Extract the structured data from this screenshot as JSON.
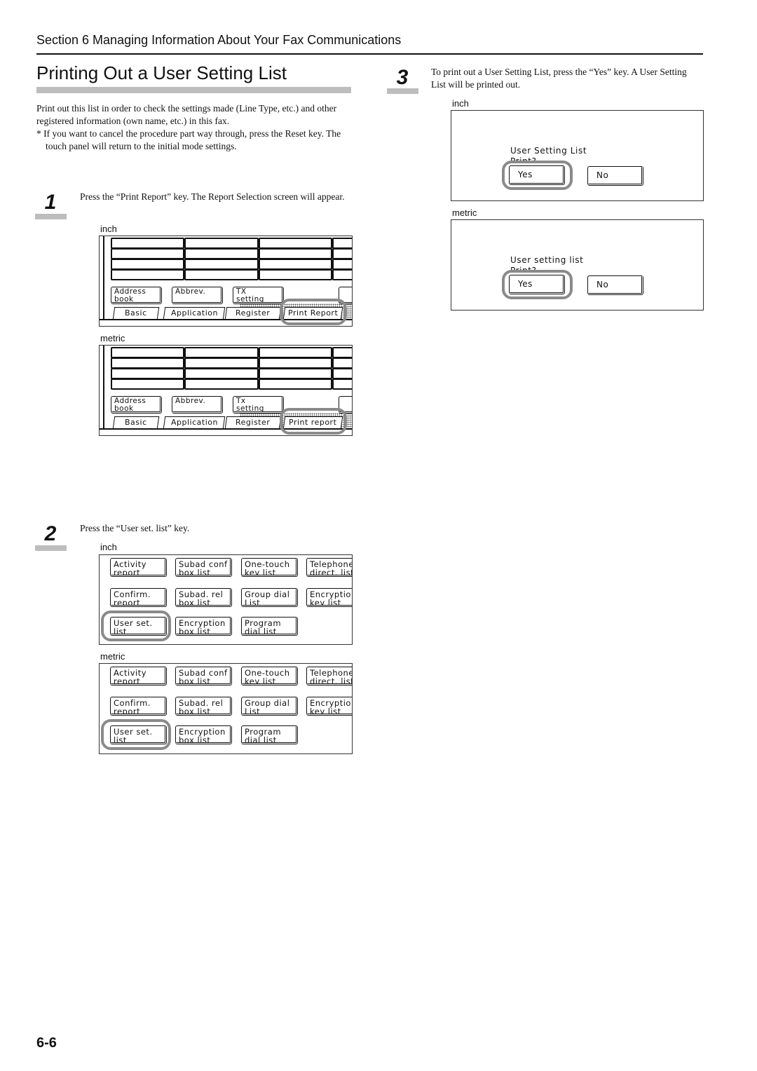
{
  "header": {
    "section": "Section 6  Managing Information About Your Fax Communications"
  },
  "title": "Printing Out a User Setting List",
  "intro": {
    "paragraph": "Print out this list in order to check the settings made (Line Type, etc.) and other registered information (own name, etc.) in this fax.",
    "note": "* If you want to cancel the procedure part way through, press the Reset key. The touch panel will return to the initial mode settings."
  },
  "steps": [
    {
      "number": "1",
      "text": "Press the “Print Report” key. The Report Selection screen will appear."
    },
    {
      "number": "2",
      "text": "Press the “User set. list” key."
    },
    {
      "number": "3",
      "text": "To print out a User Setting List, press the “Yes” key. A User Setting List will be printed out."
    }
  ],
  "labels": {
    "inch": "inch",
    "metric": "metric"
  },
  "screens": {
    "report_inch": {
      "buttons": [
        "Address\nbook",
        "Abbrev.",
        "TX\nsetting"
      ],
      "tabs": [
        "Basic",
        "Application",
        "Register",
        "Print Report"
      ]
    },
    "report_metric": {
      "buttons": [
        "Address\nbook",
        "Abbrev.",
        "Tx\nsetting"
      ],
      "tabs": [
        "Basic",
        "Application",
        "Register",
        "Print report"
      ]
    },
    "list_inch": {
      "buttons": [
        "Activity\nreport",
        "Subad conf\nbox list",
        "One-touch\nkey list",
        "Telephone\ndirect. list",
        "Confirm.\nreport",
        "Subad. rel\nbox list",
        "Group dial\nList",
        "Encryption\nkey list",
        "User set.\nlist",
        "Encryption\nbox list",
        "Program\ndial list"
      ]
    },
    "list_metric": {
      "buttons": [
        "Activity\nreport",
        "Subad conf\nbox list",
        "One-touch\nkey list",
        "Telephone\ndirect. list",
        "Confirm.\nreport",
        "Subad. rel\nbox list",
        "Group dial\nList",
        "Encryption\nkey list",
        "User set.\nlist",
        "Encryption\nbox list",
        "Program\ndial list"
      ]
    },
    "dialog_inch": {
      "message": "User Setting List",
      "prompt": "Print?",
      "yes": "Yes",
      "no": "No"
    },
    "dialog_metric": {
      "message": "User setting list",
      "prompt": "Print?",
      "yes": "Yes",
      "no": "No"
    }
  },
  "page_number": "6-6",
  "colors": {
    "highlight_ring": "#8a8a8a",
    "title_bar": "#bdbdbd"
  }
}
